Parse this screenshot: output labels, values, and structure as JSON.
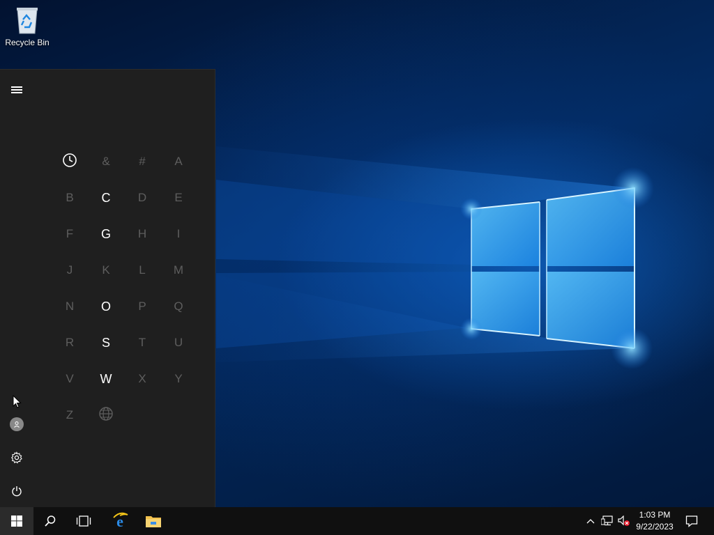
{
  "desktop": {
    "icons": [
      {
        "label": "Recycle Bin",
        "icon": "recycle-bin-icon"
      }
    ]
  },
  "start_menu": {
    "rail": {
      "menu": "hamburger-menu-icon",
      "account": "user-account-icon",
      "settings": "settings-gear-icon",
      "power": "power-icon"
    },
    "letters": [
      {
        "label": "recent",
        "icon": "clock-icon",
        "active": true
      },
      {
        "label": "&",
        "active": false
      },
      {
        "label": "#",
        "active": false
      },
      {
        "label": "A",
        "active": false
      },
      {
        "label": "B",
        "active": false
      },
      {
        "label": "C",
        "active": true
      },
      {
        "label": "D",
        "active": false
      },
      {
        "label": "E",
        "active": false
      },
      {
        "label": "F",
        "active": false
      },
      {
        "label": "G",
        "active": true
      },
      {
        "label": "H",
        "active": false
      },
      {
        "label": "I",
        "active": false
      },
      {
        "label": "J",
        "active": false
      },
      {
        "label": "K",
        "active": false
      },
      {
        "label": "L",
        "active": false
      },
      {
        "label": "M",
        "active": false
      },
      {
        "label": "N",
        "active": false
      },
      {
        "label": "O",
        "active": true
      },
      {
        "label": "P",
        "active": false
      },
      {
        "label": "Q",
        "active": false
      },
      {
        "label": "R",
        "active": false
      },
      {
        "label": "S",
        "active": true
      },
      {
        "label": "T",
        "active": false
      },
      {
        "label": "U",
        "active": false
      },
      {
        "label": "V",
        "active": false
      },
      {
        "label": "W",
        "active": true
      },
      {
        "label": "X",
        "active": false
      },
      {
        "label": "Y",
        "active": false
      },
      {
        "label": "Z",
        "active": false
      },
      {
        "label": "other",
        "icon": "globe-icon",
        "active": false
      }
    ]
  },
  "taskbar": {
    "buttons": [
      "windows-start-icon",
      "search-icon",
      "task-view-icon",
      "internet-explorer-icon",
      "file-explorer-icon"
    ],
    "tray": {
      "icons": [
        "show-hidden-icons-chevron-icon",
        "network-icon",
        "volume-muted-icon"
      ],
      "time": "1:03 PM",
      "date": "9/22/2023",
      "notifications": "action-center-icon"
    }
  },
  "colors": {
    "taskbar": "#101010",
    "start_menu": "#1f1f1f",
    "active_letter": "#ffffff",
    "inactive_letter": "#5e5e5e"
  }
}
